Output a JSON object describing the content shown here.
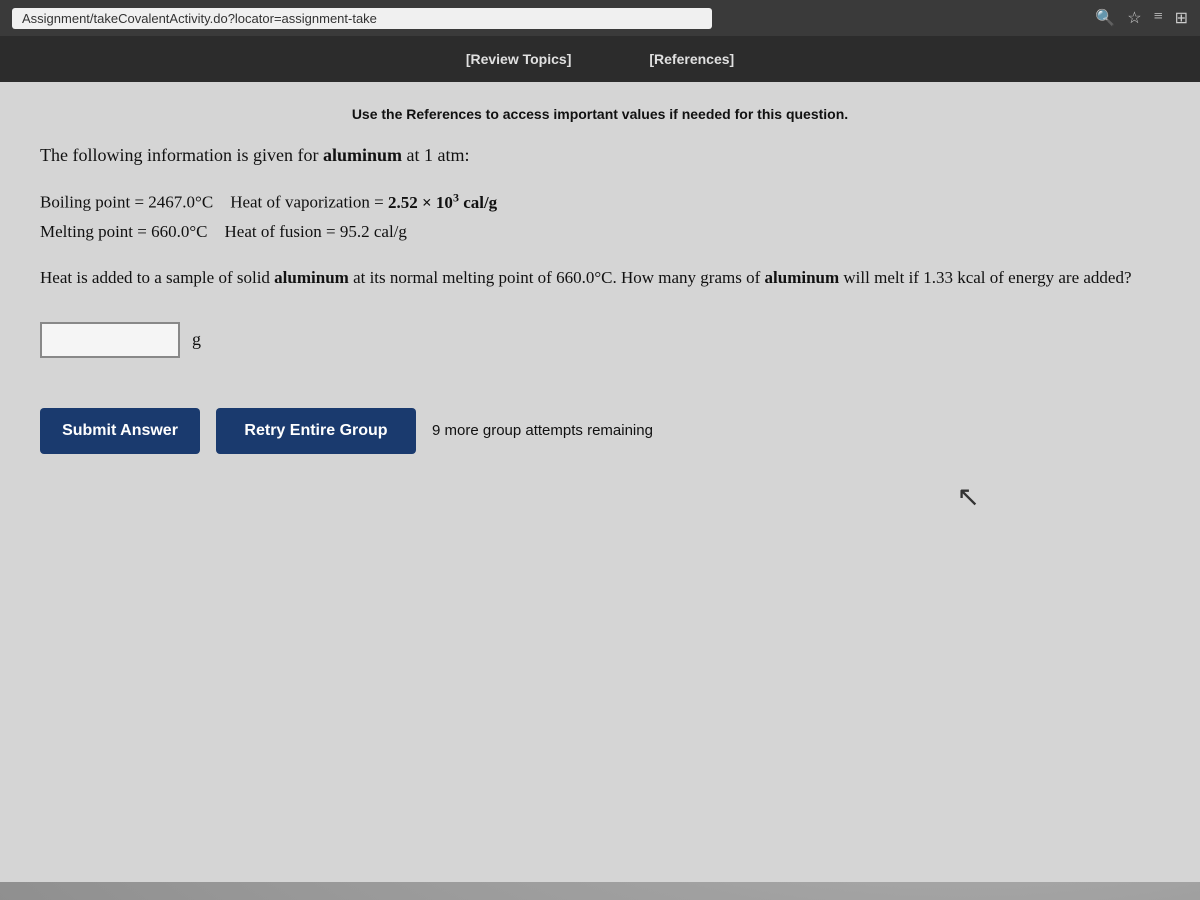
{
  "browser": {
    "url": "Assignment/takeCovalentActivity.do?locator=assignment-take",
    "icons": [
      "🔍",
      "☆",
      "≡",
      "⊞"
    ]
  },
  "nav": {
    "review_topics": "[Review Topics]",
    "references": "[References]"
  },
  "content": {
    "references_note": "Use the References to access important values if needed for this question.",
    "intro": "The following information is given for aluminum at 1 atm:",
    "boiling_point_label": "Boiling point",
    "boiling_point_value": "2467.0°C",
    "heat_vaporization_label": "Heat of vaporization",
    "heat_vaporization_value": "2.52 × 10",
    "heat_vaporization_exp": "3",
    "heat_vaporization_unit": "cal/g",
    "melting_point_label": "Melting point",
    "melting_point_value": "660.0°C",
    "heat_fusion_label": "Heat of fusion",
    "heat_fusion_value": "95.2 cal/g",
    "question_text": "Heat is added to a sample of solid aluminum at its normal melting point of 660.0°C. How many grams of aluminum will melt if 1.33 kcal of energy are added?",
    "answer_placeholder": "",
    "unit": "g",
    "submit_label": "Submit Answer",
    "retry_label": "Retry Entire Group",
    "attempts_text": "9 more group attempts remaining"
  }
}
